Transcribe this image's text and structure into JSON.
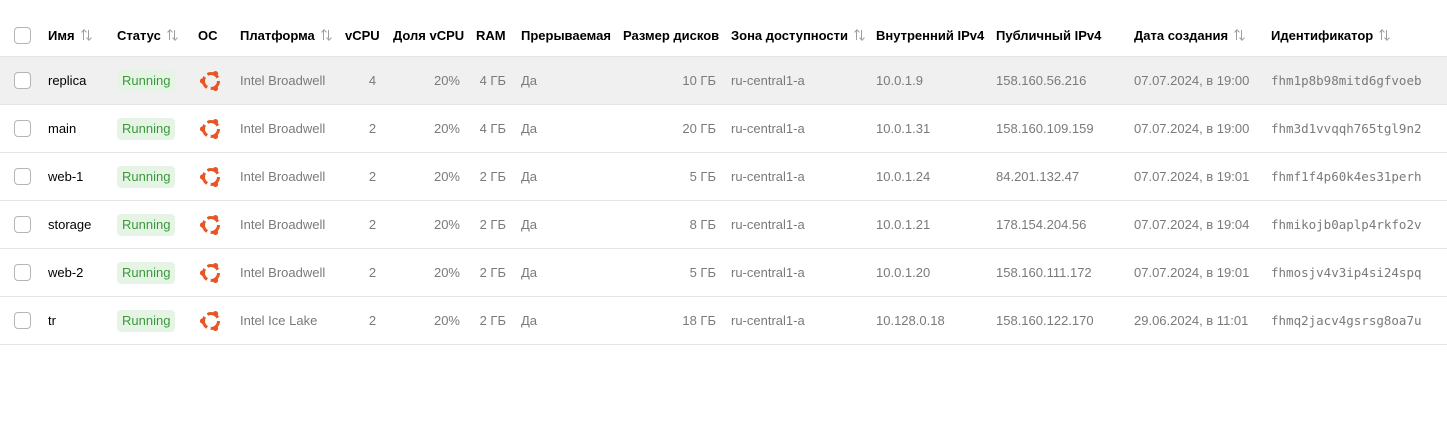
{
  "columns": {
    "name": "Имя",
    "status": "Статус",
    "os": "ОС",
    "platform": "Платформа",
    "vcpu": "vCPU",
    "vcpu_share": "Доля vCPU",
    "ram": "RAM",
    "preemptible": "Прерываемая",
    "disk_size": "Размер дисков",
    "zone": "Зона доступности",
    "internal_ip": "Внутренний IPv4",
    "public_ip": "Публичный IPv4",
    "created": "Дата создания",
    "id": "Идентификатор"
  },
  "colors": {
    "status_bg": "#e6f4e6",
    "status_text": "#3a9a3a",
    "ubuntu_orange": "#e95420",
    "hover_row": "#f0f0f0"
  },
  "rows": [
    {
      "name": "replica",
      "status": "Running",
      "os_icon": "ubuntu-icon",
      "platform": "Intel Broadwell",
      "vcpu": "4",
      "vcpu_share": "20%",
      "ram": "4 ГБ",
      "preemptible": "Да",
      "disk_size": "10 ГБ",
      "zone": "ru-central1-a",
      "internal_ip": "10.0.1.9",
      "public_ip": "158.160.56.216",
      "created": "07.07.2024, в 19:00",
      "id": "fhm1p8b98mitd6gfvoeb"
    },
    {
      "name": "main",
      "status": "Running",
      "os_icon": "ubuntu-icon",
      "platform": "Intel Broadwell",
      "vcpu": "2",
      "vcpu_share": "20%",
      "ram": "4 ГБ",
      "preemptible": "Да",
      "disk_size": "20 ГБ",
      "zone": "ru-central1-a",
      "internal_ip": "10.0.1.31",
      "public_ip": "158.160.109.159",
      "created": "07.07.2024, в 19:00",
      "id": "fhm3d1vvqqh765tgl9n2"
    },
    {
      "name": "web-1",
      "status": "Running",
      "os_icon": "ubuntu-icon",
      "platform": "Intel Broadwell",
      "vcpu": "2",
      "vcpu_share": "20%",
      "ram": "2 ГБ",
      "preemptible": "Да",
      "disk_size": "5 ГБ",
      "zone": "ru-central1-a",
      "internal_ip": "10.0.1.24",
      "public_ip": "84.201.132.47",
      "created": "07.07.2024, в 19:01",
      "id": "fhmf1f4p60k4es31perh"
    },
    {
      "name": "storage",
      "status": "Running",
      "os_icon": "ubuntu-icon",
      "platform": "Intel Broadwell",
      "vcpu": "2",
      "vcpu_share": "20%",
      "ram": "2 ГБ",
      "preemptible": "Да",
      "disk_size": "8 ГБ",
      "zone": "ru-central1-a",
      "internal_ip": "10.0.1.21",
      "public_ip": "178.154.204.56",
      "created": "07.07.2024, в 19:04",
      "id": "fhmikojb0aplp4rkfo2v"
    },
    {
      "name": "web-2",
      "status": "Running",
      "os_icon": "ubuntu-icon",
      "platform": "Intel Broadwell",
      "vcpu": "2",
      "vcpu_share": "20%",
      "ram": "2 ГБ",
      "preemptible": "Да",
      "disk_size": "5 ГБ",
      "zone": "ru-central1-a",
      "internal_ip": "10.0.1.20",
      "public_ip": "158.160.111.172",
      "created": "07.07.2024, в 19:01",
      "id": "fhmosjv4v3ip4si24spq"
    },
    {
      "name": "tr",
      "status": "Running",
      "os_icon": "ubuntu-icon",
      "platform": "Intel Ice Lake",
      "vcpu": "2",
      "vcpu_share": "20%",
      "ram": "2 ГБ",
      "preemptible": "Да",
      "disk_size": "18 ГБ",
      "zone": "ru-central1-a",
      "internal_ip": "10.128.0.18",
      "public_ip": "158.160.122.170",
      "created": "29.06.2024, в 11:01",
      "id": "fhmq2jacv4gsrsg8oa7u"
    }
  ]
}
